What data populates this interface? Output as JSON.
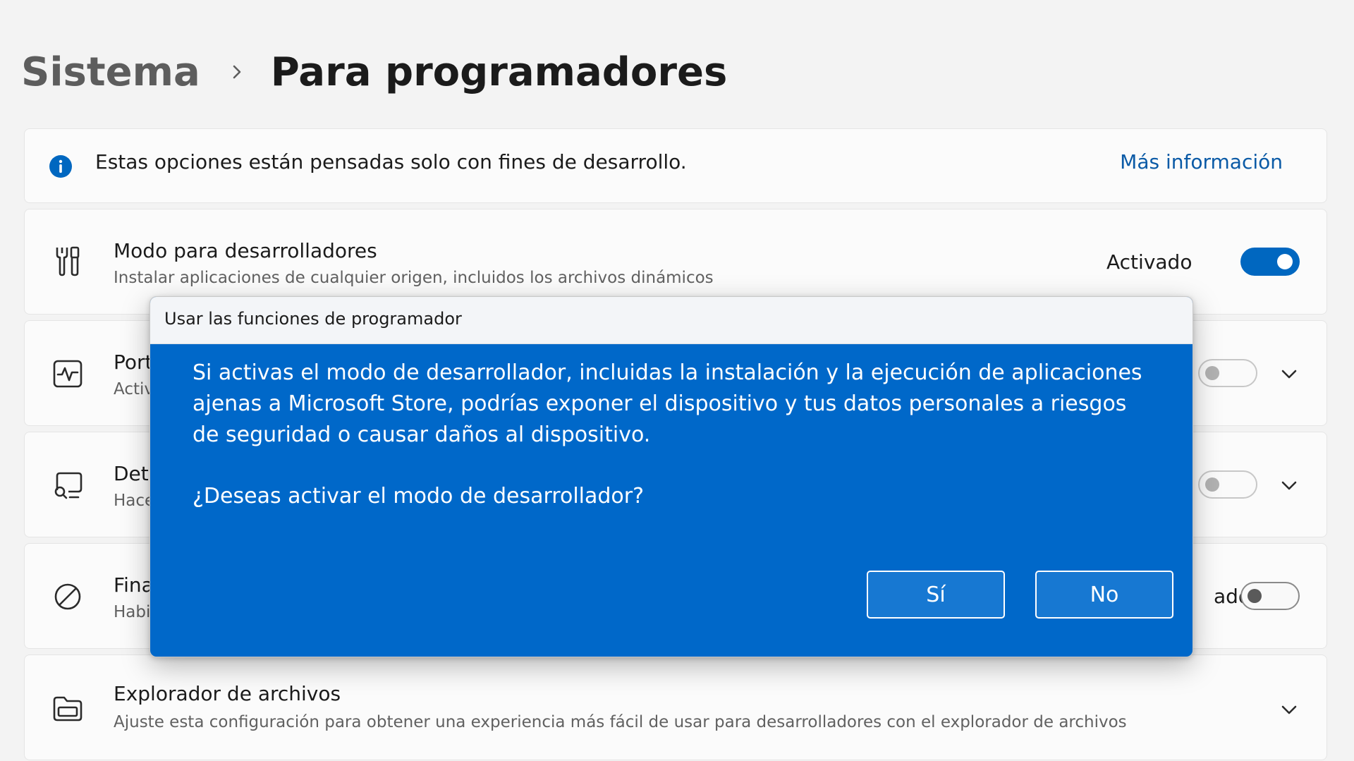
{
  "breadcrumb": {
    "parent": "Sistema",
    "current": "Para programadores"
  },
  "info_bar": {
    "icon": "info-icon",
    "text": "Estas opciones están pensadas solo con fines de desarrollo.",
    "link": "Más información"
  },
  "settings": {
    "developer_mode": {
      "icon": "tools-icon",
      "title": "Modo para desarrolladores",
      "description": "Instalar aplicaciones de cualquier origen, incluidos los archivos dinámicos",
      "status": "Activado",
      "toggle_on": true
    },
    "portal": {
      "icon": "pulse-monitor-icon",
      "title_partial": "Port",
      "description_partial": "Activ",
      "toggle_on": false
    },
    "detection": {
      "icon": "device-search-icon",
      "title_partial": "Dete",
      "description_partial": "Hace",
      "toggle_on": false
    },
    "terminate": {
      "icon": "blocked-icon",
      "title_partial": "Fina",
      "description_partial": "Habi",
      "status_partial": "ado",
      "toggle_on": false
    },
    "file_explorer": {
      "icon": "folder-icon",
      "title": "Explorador de archivos",
      "description": "Ajuste esta configuración para obtener una experiencia más fácil de usar para desarrolladores con el explorador de archivos"
    }
  },
  "dialog": {
    "title": "Usar las funciones de programador",
    "message": "Si activas el modo de desarrollador, incluidas la instalación y la ejecución de aplicaciones ajenas a Microsoft Store, podrías exponer el dispositivo y tus datos personales a riesgos de seguridad o causar daños al dispositivo.",
    "question": "¿Deseas activar el modo de desarrollador?",
    "yes_label": "Sí",
    "no_label": "No"
  },
  "colors": {
    "accent": "#0067c0",
    "dialog_background": "#0068c9",
    "link": "#0a5aa6",
    "page_background": "#f3f3f3"
  }
}
